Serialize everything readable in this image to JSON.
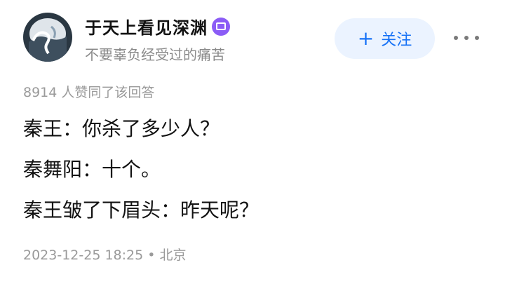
{
  "author": {
    "name": "于天上看见深渊",
    "bio": "不要辜负经受过的痛苦",
    "badge_icon": "verified-badge-icon"
  },
  "follow_button": {
    "plus": "+",
    "label": "关注"
  },
  "likes_text": "8914 人赞同了该回答",
  "answer_lines": [
    "秦王：你杀了多少人？",
    "秦舞阳：十个。",
    "秦王皱了下眉头：昨天呢？"
  ],
  "meta": {
    "datetime": "2023-12-25 18:25",
    "separator": "•",
    "location": "北京"
  },
  "colors": {
    "accent": "#1772f6",
    "follow_bg": "#ebf3ff",
    "badge": "#8b5cf6",
    "muted": "#9a9a9a"
  }
}
